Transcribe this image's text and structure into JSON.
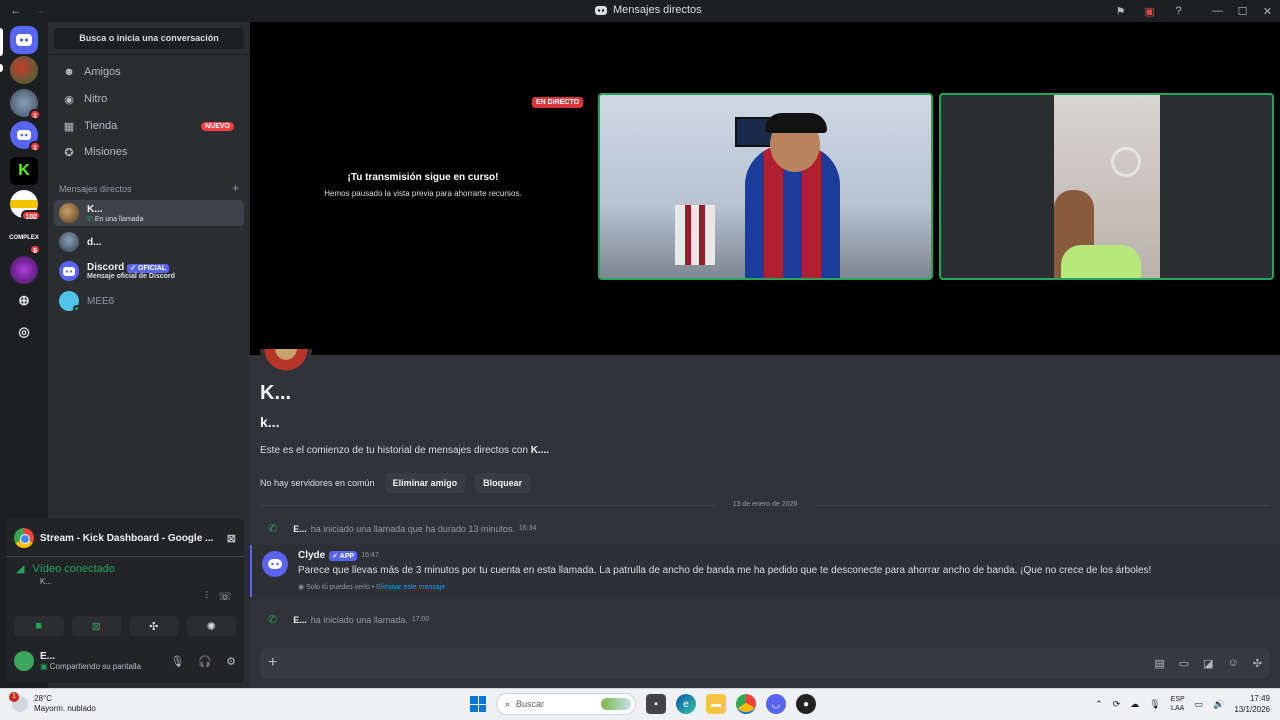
{
  "window": {
    "title": "Mensajes directos",
    "back": "←",
    "forward": "→"
  },
  "guilds": [
    {
      "id": "home",
      "label": "",
      "badge": ""
    },
    {
      "id": "server-1",
      "label": "",
      "badge": ""
    },
    {
      "id": "server-2",
      "label": "",
      "badge": "1"
    },
    {
      "id": "server-3",
      "label": "",
      "badge": "1"
    },
    {
      "id": "kick",
      "label": "K",
      "badge": ""
    },
    {
      "id": "server-5",
      "label": "",
      "badge": "102"
    },
    {
      "id": "complex",
      "label": "COMPLEX",
      "badge": "6"
    },
    {
      "id": "server-7",
      "label": "",
      "badge": ""
    }
  ],
  "sidebar": {
    "search": "Busca o inicia una conversación",
    "nav": [
      {
        "label": "Amigos",
        "icon": "friends-icon"
      },
      {
        "label": "Nitro",
        "icon": "nitro-icon"
      },
      {
        "label": "Tienda",
        "icon": "shop-icon",
        "badge": "NUEVO"
      },
      {
        "label": "Misiones",
        "icon": "quests-icon"
      }
    ],
    "dm_header": "Mensajes directos",
    "dm_add": "+",
    "dms": [
      {
        "name": "K...",
        "sub": "En una llamada"
      },
      {
        "name": "d...",
        "sub": ""
      },
      {
        "name": "Discord",
        "tag": "OFICIAL",
        "sub": "Mensaje oficial de Discord"
      },
      {
        "name": "MEE6",
        "sub": ""
      }
    ]
  },
  "panel": {
    "stream": "Stream - Kick Dashboard - Google ...",
    "voice_status": "Vídeo conectado",
    "voice_channel": "K...",
    "user_name": "E...",
    "user_status": "Compartiendo su pantalla"
  },
  "stage": {
    "live_badge": "EN DIRECTO",
    "paused_title": "¡Tu transmisión sigue en curso!",
    "paused_sub": "Hemos pausado la vista previa para ahorrarte recursos."
  },
  "chat": {
    "title": "K...",
    "handle": "k...",
    "intro_prefix": "Este es el comienzo de tu historial de mensajes directos con ",
    "intro_name": "K....",
    "mutual": "No hay servidores en común",
    "remove_friend": "Eliminar amigo",
    "block": "Bloquear",
    "date": "13 de enero de 2026",
    "call1": {
      "user": "E...",
      "text": "ha iniciado una llamada que ha durado 13 minutos.",
      "time": "16:34"
    },
    "clyde": {
      "name": "Clyde",
      "tag": "APP",
      "time": "16:47",
      "text": "Parece que llevas más de 3 minutos por tu cuenta en esta llamada. La patrulla de ancho de banda me ha pedido que te desconecte para ahorrar ancho de banda. ¡Que no crece de los árboles!",
      "note": "Solo tú puedes verlo • ",
      "note_link": "Eliminar este mensaje"
    },
    "call2": {
      "user": "E...",
      "text": "ha iniciado una llamada.",
      "time": "17:00"
    }
  },
  "taskbar": {
    "temp": "28°C",
    "weather": "Mayorm. nublado",
    "weather_badge": "1",
    "search": "Buscar",
    "lang1": "ESP",
    "lang2": "LAA",
    "time": "17:49",
    "date": "13/1/2026"
  }
}
